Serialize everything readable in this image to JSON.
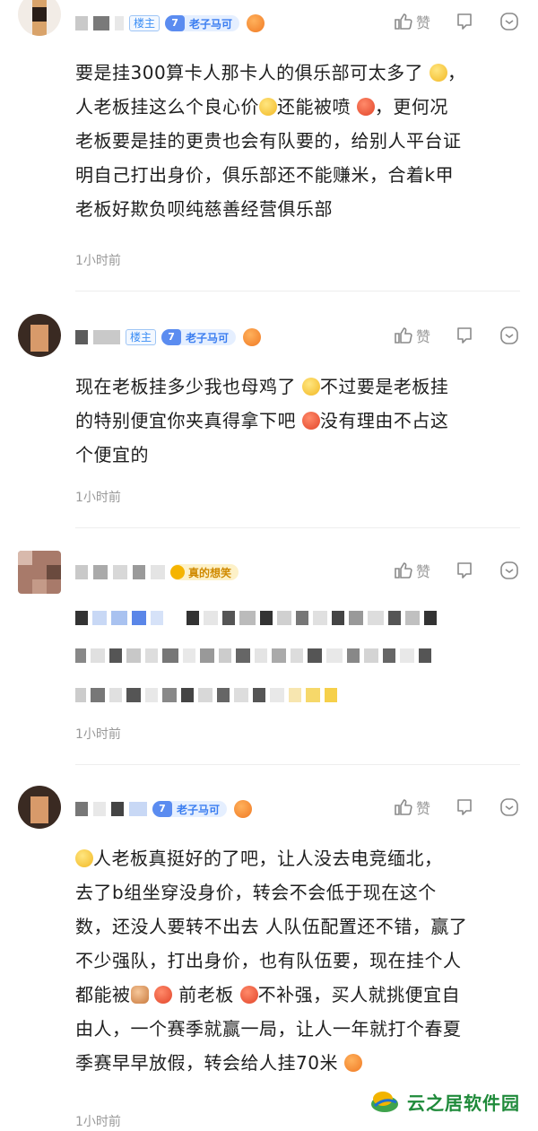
{
  "comments": [
    {
      "badge_owner": "楼主",
      "fan_badge": {
        "level": "7",
        "name": "老子马可"
      },
      "actions": {
        "like_label": "赞"
      },
      "lines": [
        "要是挂300算卡人那卡人的俱乐部可太多了",
        "人老板挂这么个良心价",
        "还能被喷",
        "，更何况",
        "老板要是挂的更贵也会有队要的，给别人平台证",
        "明自己打出身价，俱乐部还不能赚米，合着k甲",
        "老板好欺负呗纯慈善经营俱乐部"
      ],
      "time": "1小时前"
    },
    {
      "badge_owner": "楼主",
      "fan_badge": {
        "level": "7",
        "name": "老子马可"
      },
      "actions": {
        "like_label": "赞"
      },
      "lines": [
        "现在老板挂多少我也母鸡了",
        "不过要是老板挂",
        "的特别便宜你夹真得拿下吧",
        "没有理由不占这",
        "个便宜的"
      ],
      "time": "1小时前"
    },
    {
      "gold_badge": {
        "name": "真的想笑"
      },
      "actions": {
        "like_label": "赞"
      },
      "time": "1小时前"
    },
    {
      "fan_badge": {
        "level": "7",
        "name": "老子马可"
      },
      "actions": {
        "like_label": "赞"
      },
      "lines": [
        "人老板真挺好的了吧，让人没去电竞缅北，",
        "去了b组坐穿没身价，转会不会低于现在这个",
        "数，还没人要转不出去 人队伍配置还不错，赢了",
        "不少强队，打出身价，也有队伍要，现在挂个人",
        "都能被",
        "前老板",
        "不补强，买人就挑便宜自",
        "由人，一个赛季就赢一局，让人一年就打个春夏",
        "季赛早早放假，转会给人挂70米"
      ],
      "time": "1小时前"
    }
  ],
  "watermark": {
    "text": "云之居软件园"
  }
}
